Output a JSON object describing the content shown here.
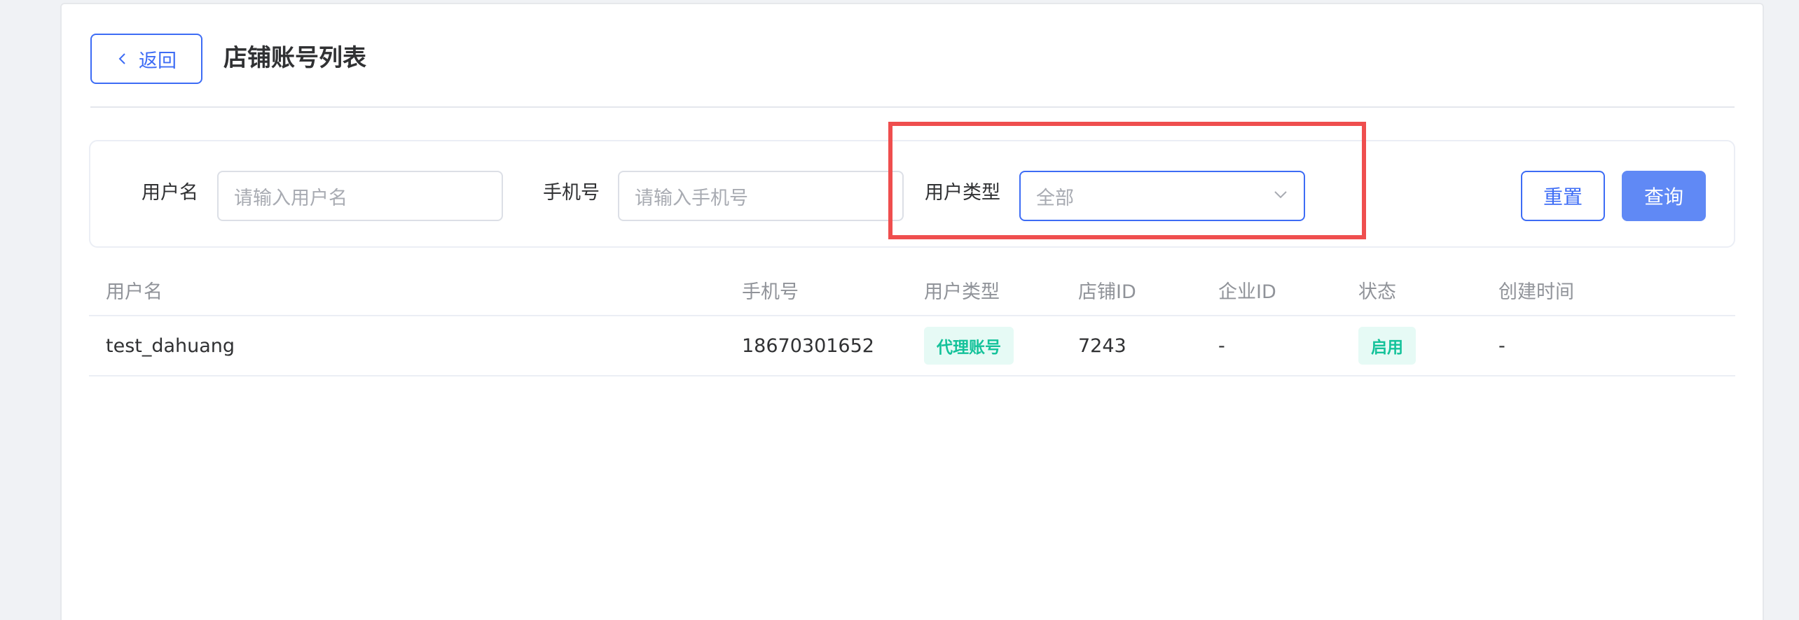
{
  "header": {
    "back_label": "返回",
    "title": "店铺账号列表"
  },
  "filter": {
    "username_label": "用户名",
    "username_placeholder": "请输入用户名",
    "phone_label": "手机号",
    "phone_placeholder": "请输入手机号",
    "type_label": "用户类型",
    "type_value": "全部",
    "reset_label": "重置",
    "query_label": "查询"
  },
  "table": {
    "columns": [
      "用户名",
      "手机号",
      "用户类型",
      "店铺ID",
      "企业ID",
      "状态",
      "创建时间"
    ],
    "rows": [
      {
        "username": "test_dahuang",
        "phone": "18670301652",
        "user_type": "代理账号",
        "shop_id": "7243",
        "company_id": "-",
        "status": "启用",
        "created_at": "-"
      }
    ]
  },
  "colors": {
    "primary": "#3d6cf5",
    "query_bg": "#6089f5",
    "tag_text": "#14c29a",
    "tag_bg": "#e6faf5",
    "highlight": "#ef4e4e"
  }
}
